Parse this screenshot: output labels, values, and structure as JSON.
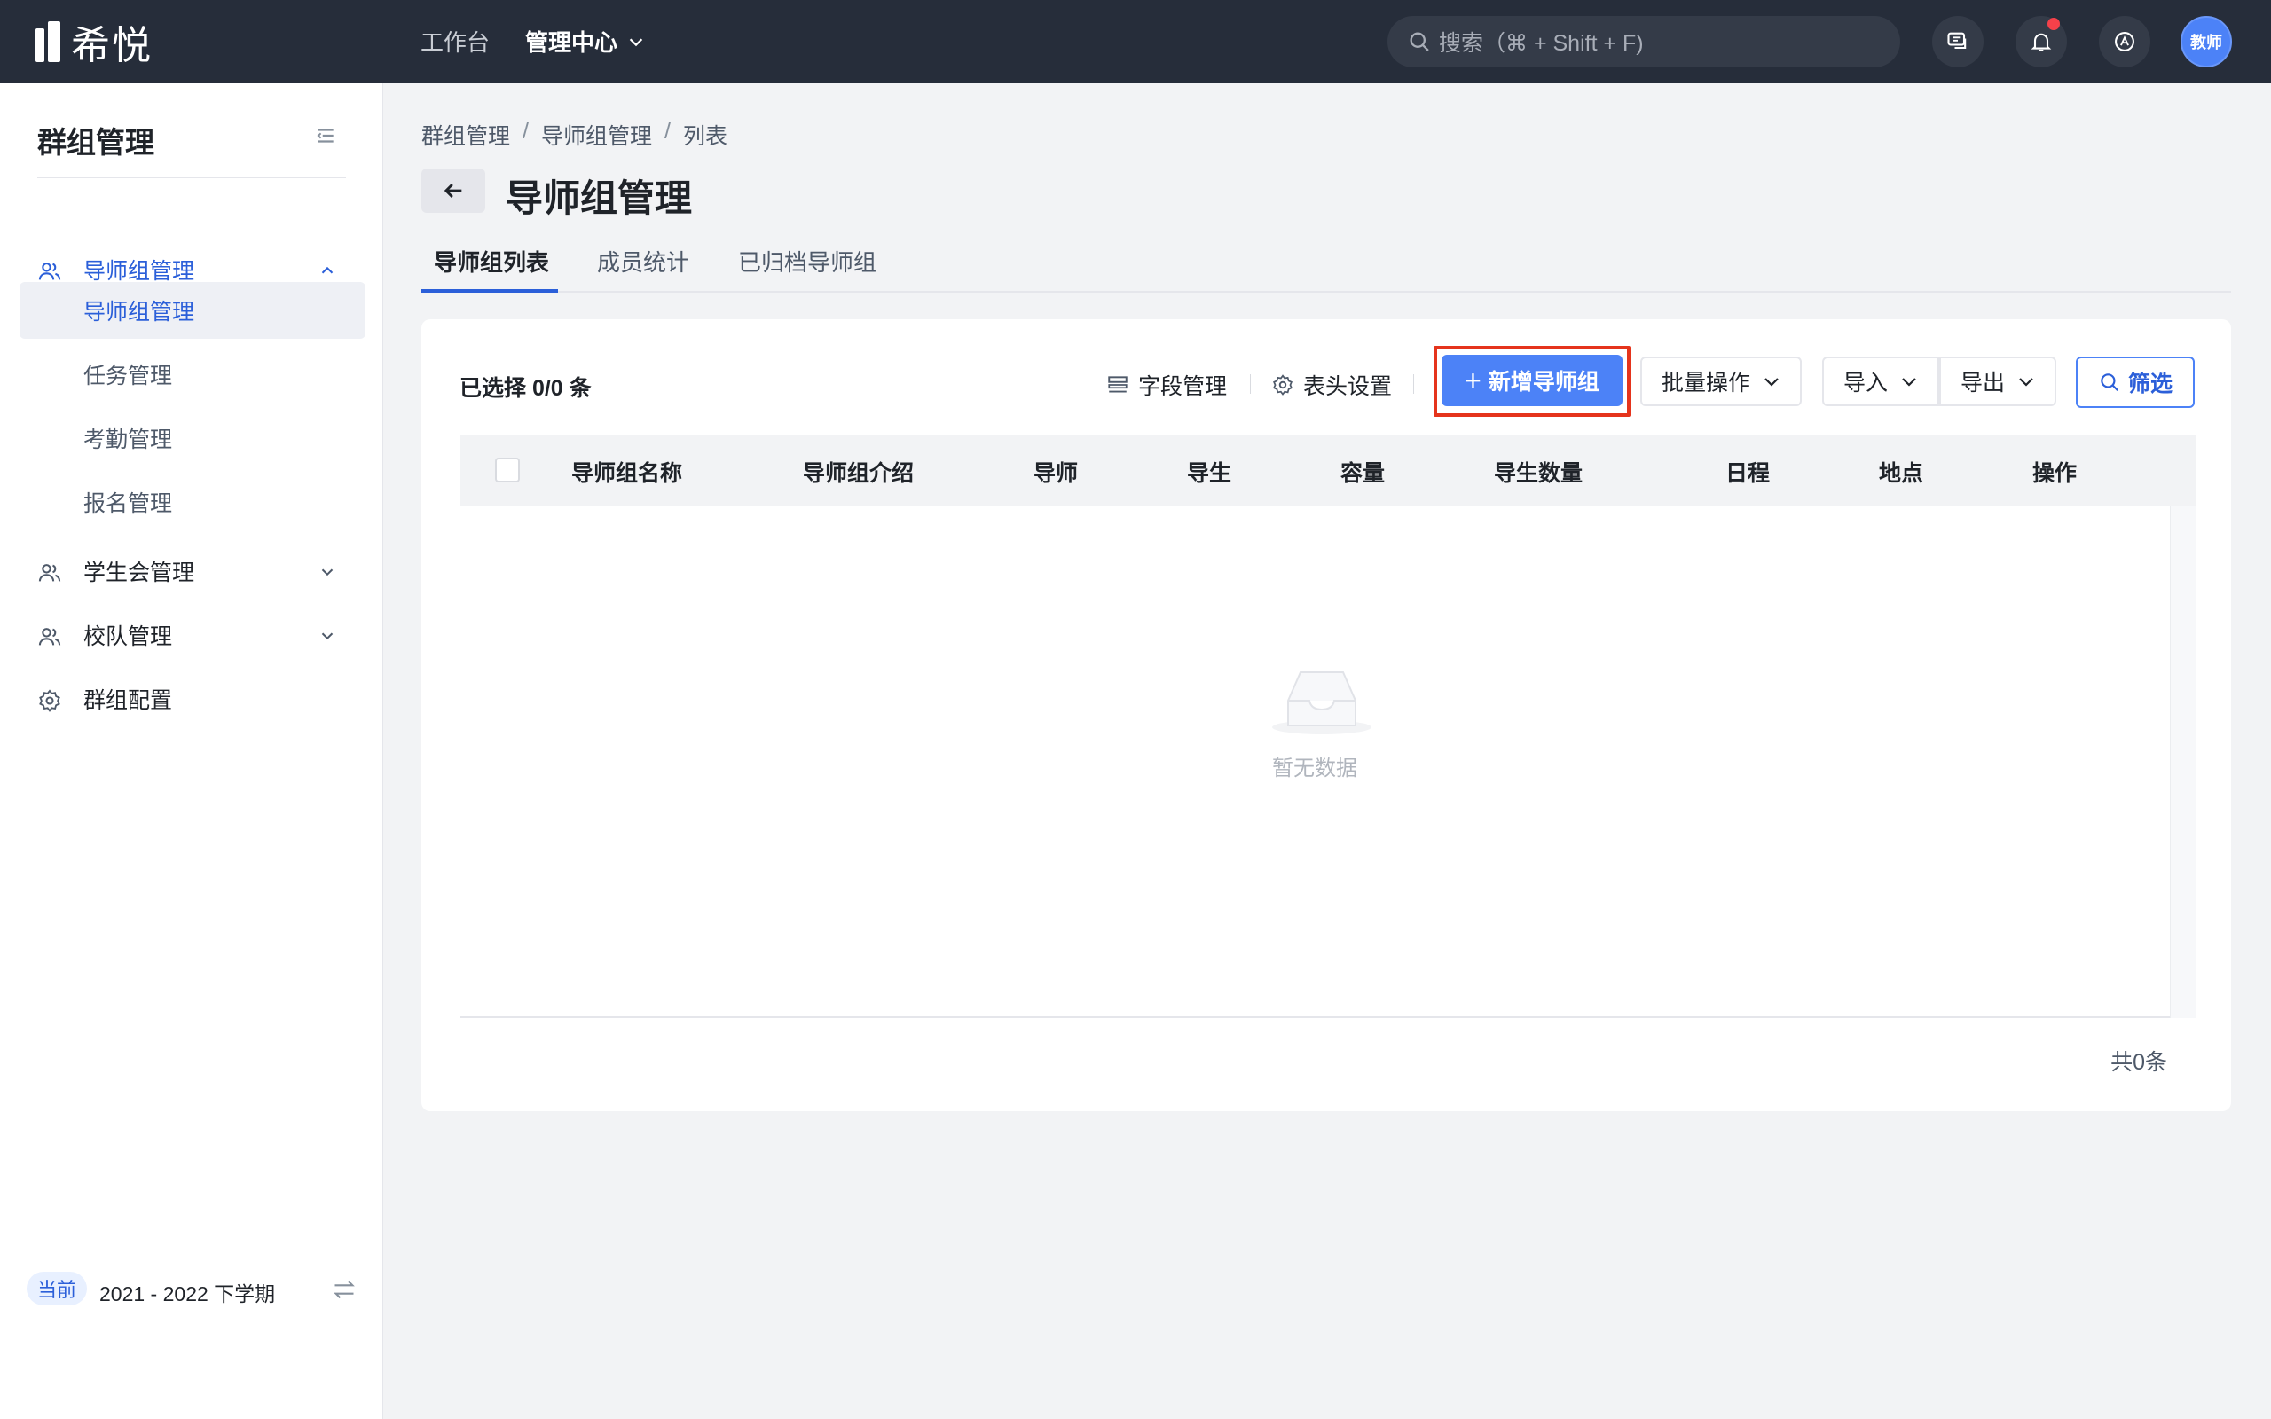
{
  "app": {
    "logo_text": "希悦",
    "nav": [
      "工作台",
      "管理中心"
    ],
    "search_placeholder": "搜索（⌘ + Shift + F)",
    "avatar_label": "教师"
  },
  "sidebar": {
    "title": "群组管理",
    "groups": [
      {
        "label": "导师组管理",
        "expanded": true
      },
      {
        "label": "学生会管理",
        "expanded": false
      },
      {
        "label": "校队管理",
        "expanded": false
      },
      {
        "label": "群组配置"
      }
    ],
    "sub_items": [
      "导师组管理",
      "任务管理",
      "考勤管理",
      "报名管理"
    ],
    "term_tag": "当前",
    "term": "2021 - 2022 下学期"
  },
  "main": {
    "breadcrumb": [
      "群组管理",
      "导师组管理",
      "列表"
    ],
    "title": "导师组管理",
    "tabs": [
      "导师组列表",
      "成员统计",
      "已归档导师组"
    ],
    "selected": "已选择 0/0 条",
    "toolbar": {
      "fields": "字段管理",
      "header_settings": "表头设置",
      "add": "新增导师组",
      "batch": "批量操作",
      "import": "导入",
      "export": "导出",
      "filter": "筛选"
    },
    "columns": [
      "导师组名称",
      "导师组介绍",
      "导师",
      "导生",
      "容量",
      "导生数量",
      "日程",
      "地点",
      "操作"
    ],
    "empty_text": "暂无数据",
    "total": "共0条"
  },
  "colors": {
    "topbar": "#262d3a",
    "primary": "#4c82f7",
    "accent_text": "#2b5fd9",
    "highlight": "#e5341c"
  }
}
